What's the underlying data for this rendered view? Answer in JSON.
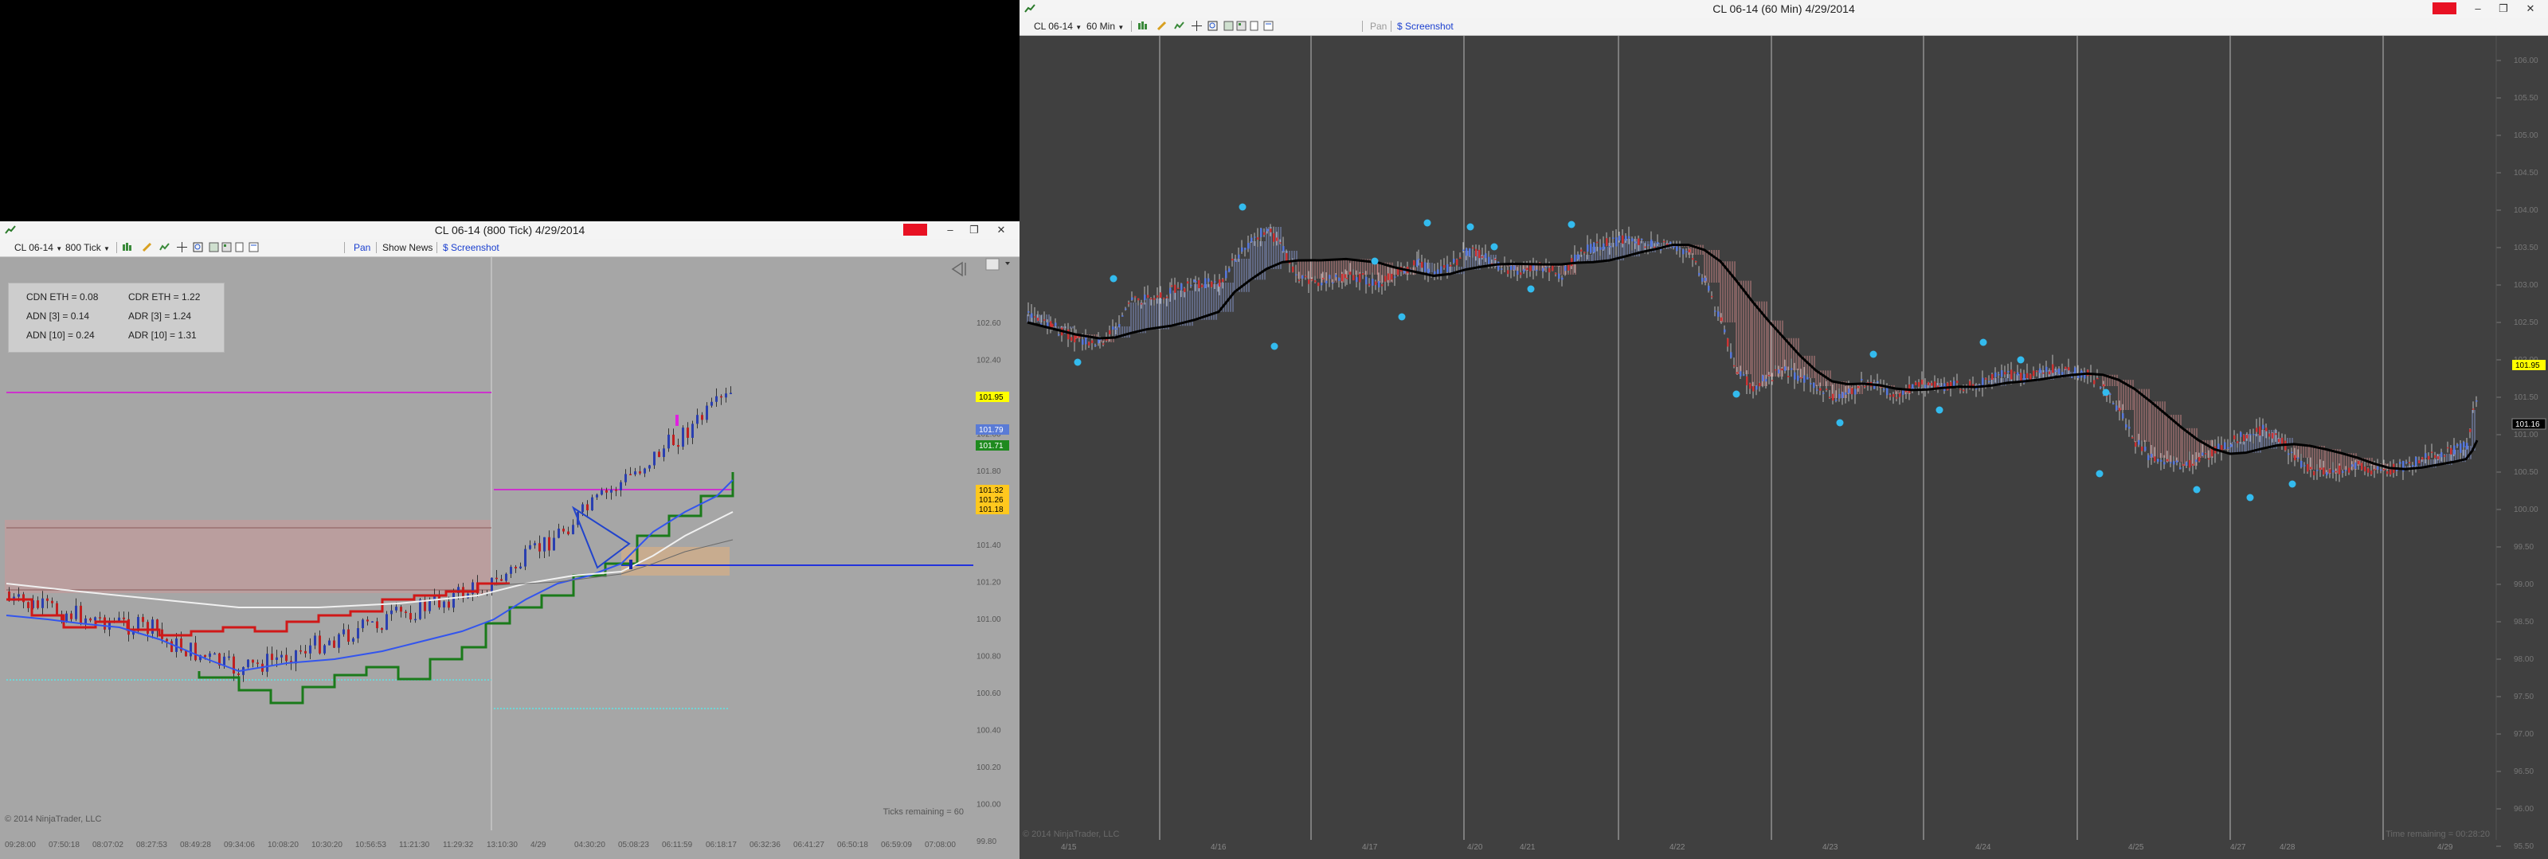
{
  "left_window": {
    "title": "CL 06-14 (800 Tick)  4/29/2014",
    "toolbar": {
      "instrument": "CL 06-14",
      "interval": "800 Tick",
      "pan": "Pan",
      "show_news": "Show News",
      "screenshot": "Screenshot"
    },
    "info": {
      "cdn_eth": "CDN ETH = 0.08",
      "cdr_eth": "CDR ETH = 1.22",
      "adn3": "ADN [3] = 0.14",
      "adr3": "ADR [3] = 1.24",
      "adn10": "ADN [10] = 0.24",
      "adr10": "ADR [10] = 1.31"
    },
    "copyright": "© 2014 NinjaTrader, LLC",
    "ticks_remaining": "Ticks remaining = 60",
    "price_axis": [
      "102.60",
      "102.40",
      "102.20",
      "102.00",
      "101.80",
      "101.60",
      "101.40",
      "101.20",
      "101.00",
      "100.80",
      "100.60",
      "100.40",
      "100.20",
      "100.00",
      "99.80"
    ],
    "price_badges": [
      {
        "value": "101.95",
        "color": "#ffff00"
      },
      {
        "value": "101.79",
        "color": "#5a7bd6"
      },
      {
        "value": "101.71",
        "color": "#1f8a1f"
      },
      {
        "value": "101.32",
        "color": "#ffc81e"
      },
      {
        "value": "101.26",
        "color": "#ffc81e"
      },
      {
        "value": "101.18",
        "color": "#ffc81e"
      }
    ],
    "time_axis": [
      "09:28:00",
      "07:50:18",
      "08:07:02",
      "08:27:53",
      "08:49:28",
      "09:34:06",
      "10:08:20",
      "10:30:20",
      "10:56:53",
      "11:21:30",
      "11:29:32",
      "13:10:30",
      "4/29",
      "04:30:20",
      "05:08:23",
      "06:11:59",
      "06:18:17",
      "06:32:36",
      "06:41:27",
      "06:50:18",
      "06:59:09",
      "07:08:00"
    ]
  },
  "right_window": {
    "title": "CL 06-14 (60 Min)  4/29/2014",
    "toolbar": {
      "instrument": "CL 06-14",
      "interval": "60 Min",
      "pan": "Pan",
      "screenshot": "Screenshot"
    },
    "copyright": "© 2014 NinjaTrader, LLC",
    "time_remaining": "Time remaining = 00:28:20",
    "price_axis": [
      "106.00",
      "105.50",
      "105.00",
      "104.50",
      "104.00",
      "103.50",
      "103.00",
      "102.50",
      "102.00",
      "101.50",
      "101.00",
      "100.50",
      "100.00",
      "99.50",
      "99.00",
      "98.50",
      "98.00",
      "97.50",
      "97.00",
      "96.50",
      "96.00",
      "95.50"
    ],
    "price_badges": [
      {
        "value": "101.95",
        "color": "#ffff00"
      },
      {
        "value": "101.16",
        "color": "#000000"
      }
    ],
    "date_axis": [
      "4/15",
      "4/16",
      "4/17",
      "4/20",
      "4/21",
      "4/22",
      "4/23",
      "4/24",
      "4/25",
      "4/27",
      "4/28",
      "4/29"
    ]
  },
  "colors": {
    "chart_bg_left": "#a6a6a6",
    "chart_bg_right": "#404040",
    "up_candle": "#5577dd",
    "down_candle": "#cc3333",
    "accent": "#e81123"
  }
}
